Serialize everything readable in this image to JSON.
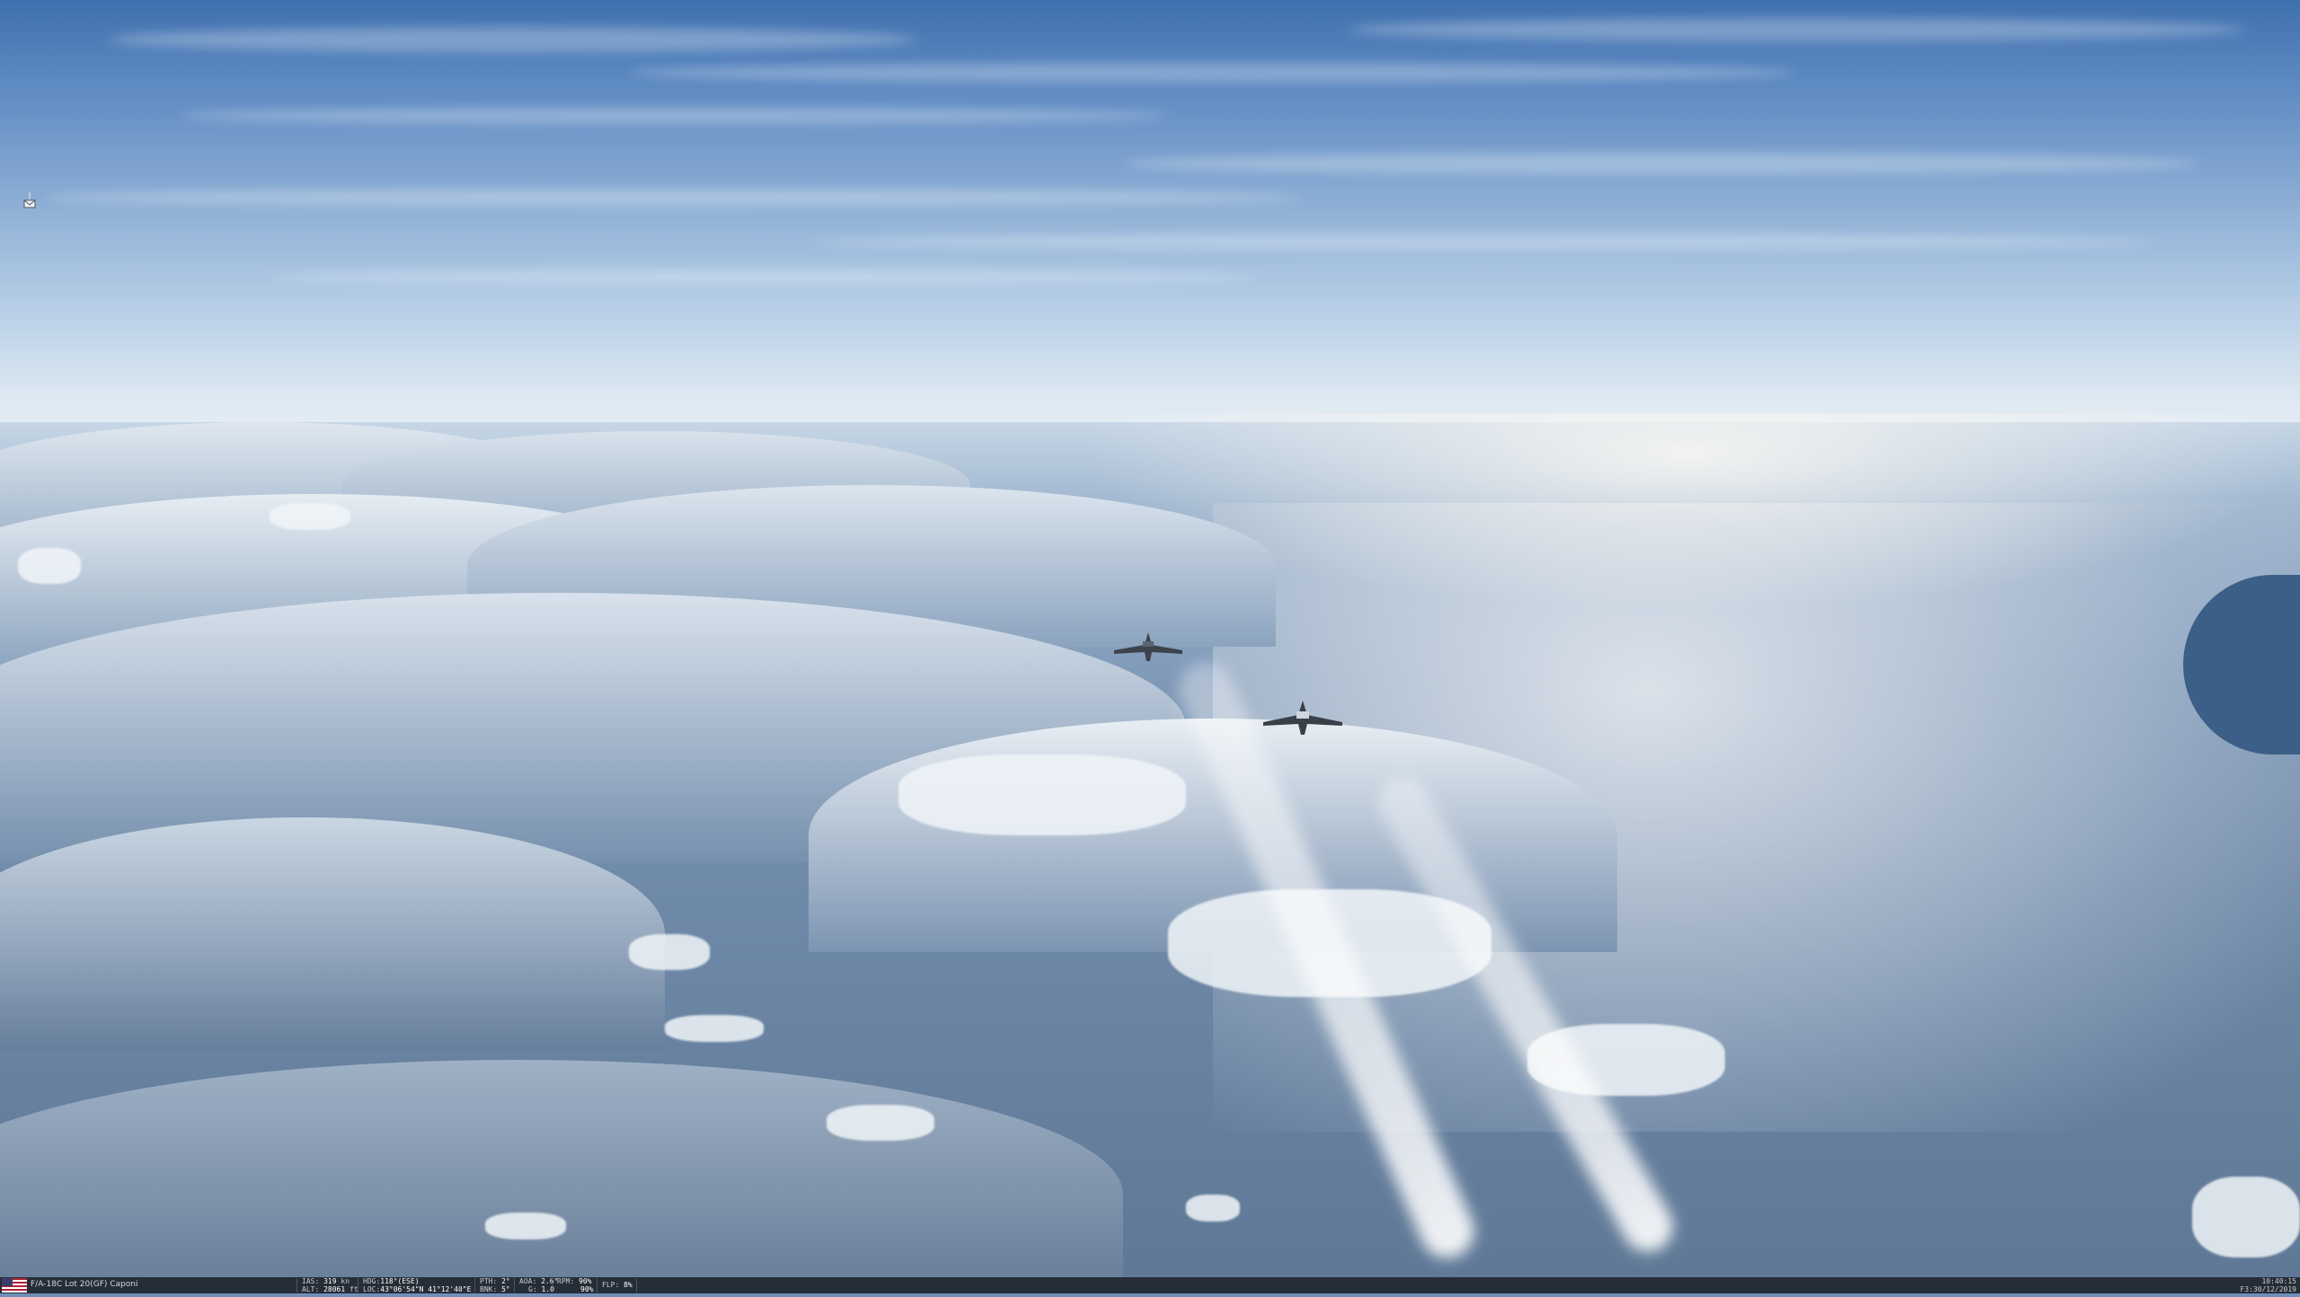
{
  "status_bar": {
    "aircraft": "F/A-18C Lot 20(GF) Caponi",
    "ias_label": "IAS:",
    "ias_value": "319",
    "ias_unit": "kn",
    "alt_label": "ALT:",
    "alt_value": "28061",
    "alt_unit": "ft",
    "hdg_label": "HDG:",
    "hdg_value": "118°(ESE)",
    "loc_label": "LOC:",
    "loc_value": "43°06'54\"N 41°12'40\"E",
    "pth_label": "PTH:",
    "pth_value": "2°",
    "bnk_label": "BNK:",
    "bnk_value": "5°",
    "aoa_label": "AOA:",
    "aoa_value": "2.6°",
    "g_label": "G:",
    "g_value": "1.0",
    "rpm_label": "RPM:",
    "rpm_value_1": "90%",
    "rpm_value_2": "90%",
    "flp_label": "FLP:",
    "flp_value": "8%",
    "time": "10:40:15",
    "date": "F3:30/12/2019"
  },
  "icons": {
    "flag": "usa-flag-icon",
    "mail": "mail-icon"
  },
  "colors": {
    "status_bg": "#252d37",
    "status_text": "#c8ccd0",
    "sky_top": "#3f6fae",
    "horizon": "#eef2f5"
  }
}
